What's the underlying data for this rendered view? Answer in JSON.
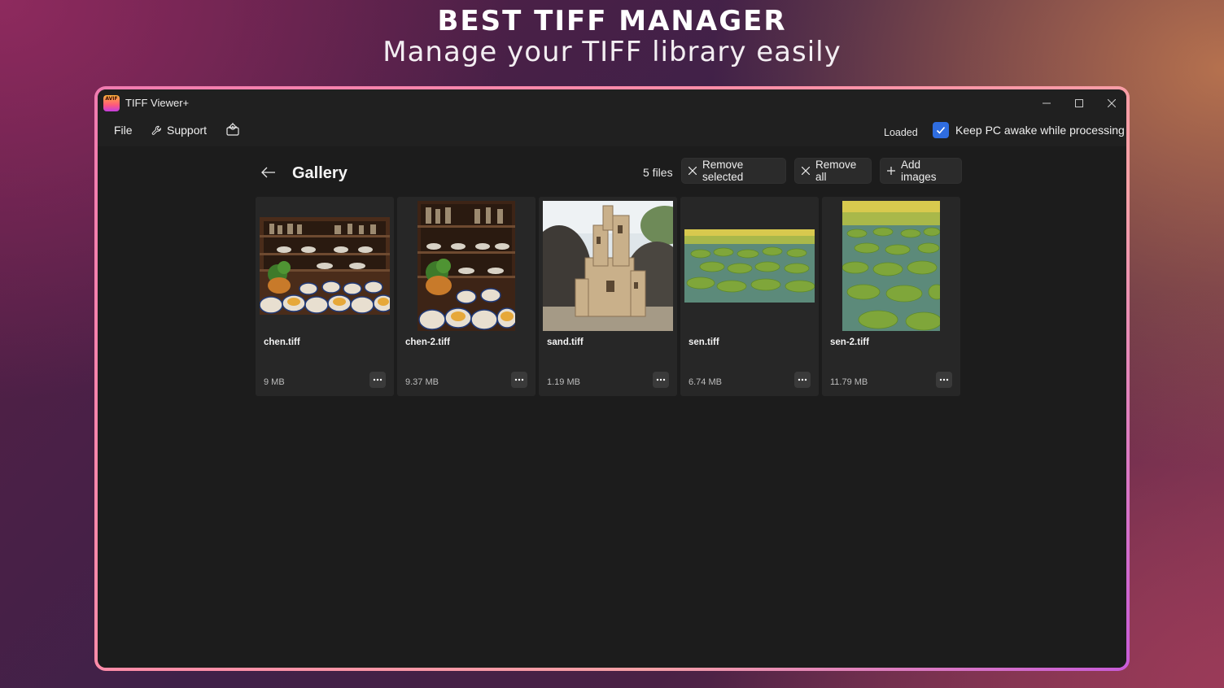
{
  "promo": {
    "title": "BEST TIFF MANAGER",
    "subtitle": "Manage your TIFF library easily"
  },
  "window": {
    "app_icon_text": "AVIF",
    "title": "TIFF Viewer+",
    "controls": [
      "minimize-icon",
      "maximize-icon",
      "close-icon"
    ]
  },
  "menubar": {
    "file": "File",
    "support": "Support",
    "extra_icon": "settings-gear-icon",
    "status": "Loaded",
    "keep_awake_label": "Keep PC awake while processing",
    "keep_awake_checked": true
  },
  "gallery": {
    "title": "Gallery",
    "file_count": "5 files",
    "remove_selected": "Remove selected",
    "remove_all": "Remove all",
    "add_images": "Add images",
    "items": [
      {
        "name": "chen.tiff",
        "size": "9 MB",
        "thumb": "pottery-shelf"
      },
      {
        "name": "chen-2.tiff",
        "size": "9.37 MB",
        "thumb": "pottery-shelf-portrait"
      },
      {
        "name": "sand.tiff",
        "size": "1.19 MB",
        "thumb": "sand-castle"
      },
      {
        "name": "sen.tiff",
        "size": "6.74 MB",
        "thumb": "lily-pads"
      },
      {
        "name": "sen-2.tiff",
        "size": "11.79 MB",
        "thumb": "lily-pads-portrait"
      }
    ]
  },
  "colors": {
    "accent": "#2f6de0",
    "window_bg": "#1c1c1c",
    "card_bg": "#272727"
  }
}
